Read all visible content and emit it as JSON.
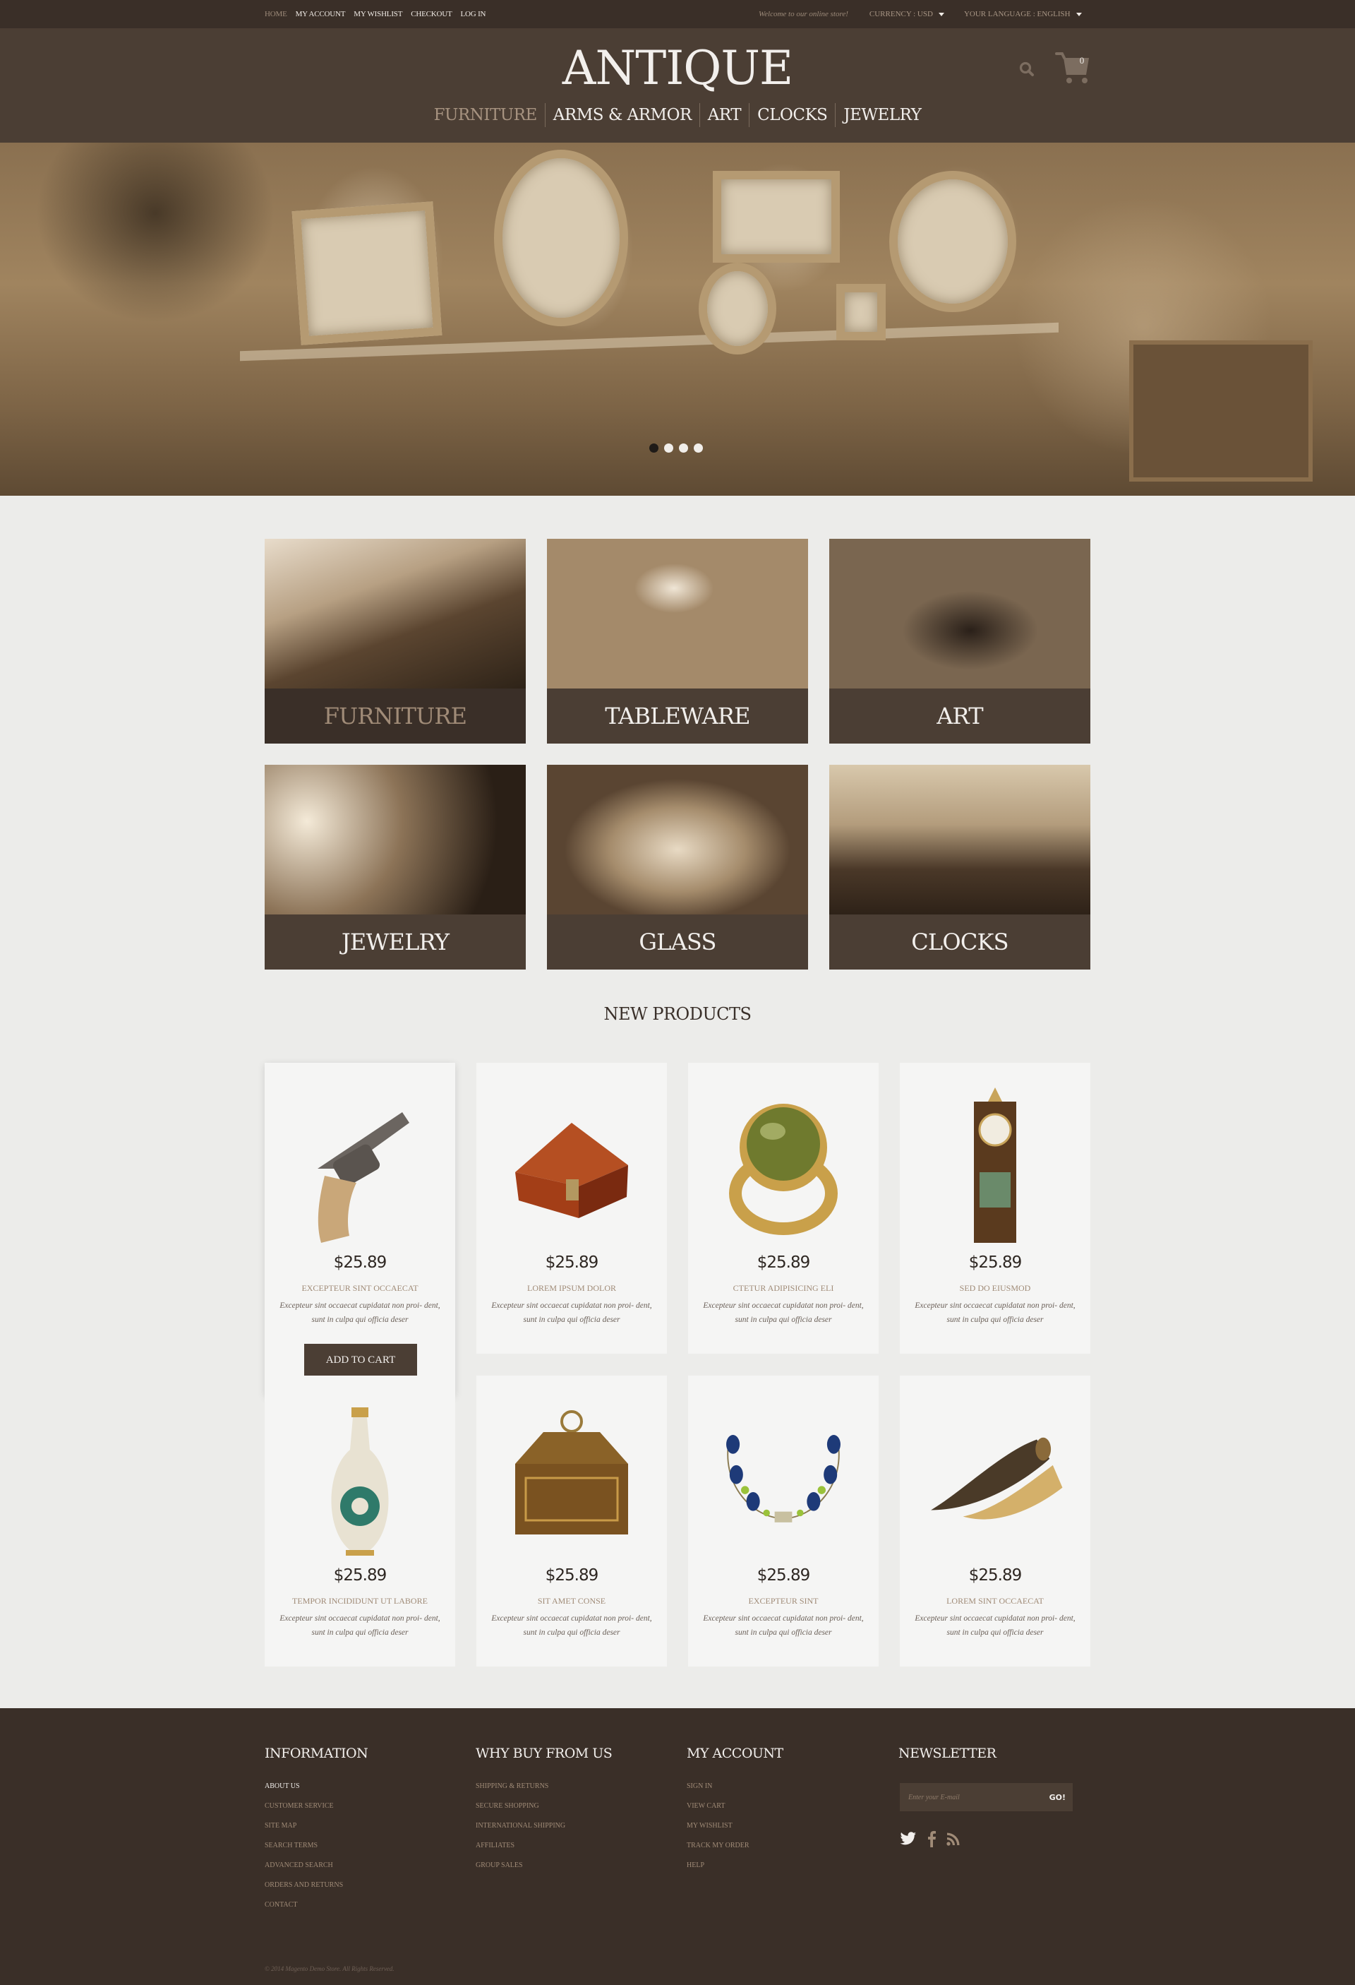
{
  "topbar": {
    "links": [
      {
        "label": "HOME",
        "active": true
      },
      {
        "label": "MY ACCOUNT",
        "active": false
      },
      {
        "label": "MY WISHLIST",
        "active": false
      },
      {
        "label": "CHECKOUT",
        "active": false
      },
      {
        "label": "LOG IN",
        "active": false
      }
    ],
    "welcome": "Welcome to our online store!",
    "currency": "CURRENCY : USD",
    "language": "YOUR LANGUAGE : ENGLISH"
  },
  "header": {
    "logo": "ANTIQUE",
    "cart_count": "0",
    "icons": {
      "search": "search-icon",
      "cart": "cart-icon"
    },
    "nav": [
      {
        "label": "FURNITURE",
        "active": true
      },
      {
        "label": "ARMS & ARMOR",
        "active": false
      },
      {
        "label": "ART",
        "active": false
      },
      {
        "label": "CLOCKS",
        "active": false
      },
      {
        "label": "JEWELRY",
        "active": false
      }
    ]
  },
  "slider": {
    "slide_count": 4,
    "active_slide": 1
  },
  "categories": [
    {
      "label": "FURNITURE",
      "active": true
    },
    {
      "label": "TABLEWARE",
      "active": false
    },
    {
      "label": "ART",
      "active": false
    },
    {
      "label": "JEWELRY",
      "active": false
    },
    {
      "label": "GLASS",
      "active": false
    },
    {
      "label": "CLOCKS",
      "active": false
    }
  ],
  "new_products": {
    "title": "NEW PRODUCTS",
    "add_to_cart_label": "ADD TO CART",
    "items": [
      {
        "price": "$25.89",
        "name": "EXCEPTEUR SINT OCCAECAT",
        "desc": "Excepteur sint occaecat cupidatat non proi- dent, sunt in culpa qui officia deser",
        "image": "revolver"
      },
      {
        "price": "$25.89",
        "name": "LOREM IPSUM DOLOR",
        "desc": "Excepteur sint occaecat cupidatat non proi- dent, sunt in culpa qui officia deser",
        "image": "wooden-chest"
      },
      {
        "price": "$25.89",
        "name": "CTETUR ADIPISICING ELI",
        "desc": "Excepteur sint occaecat cupidatat non proi- dent, sunt in culpa qui officia deser",
        "image": "gem-ring"
      },
      {
        "price": "$25.89",
        "name": "SED DO EIUSMOD",
        "desc": "Excepteur sint occaecat cupidatat non proi- dent, sunt in culpa qui officia deser",
        "image": "mantel-clock"
      },
      {
        "price": "$25.89",
        "name": "TEMPOR INCIDIDUNT UT LABORE",
        "desc": "Excepteur sint occaecat cupidatat non proi- dent, sunt in culpa qui officia deser",
        "image": "vase"
      },
      {
        "price": "$25.89",
        "name": "SIT AMET CONSE",
        "desc": "Excepteur sint occaecat cupidatat non proi- dent, sunt in culpa qui officia deser",
        "image": "ornate-box"
      },
      {
        "price": "$25.89",
        "name": "EXCEPTEUR SINT",
        "desc": "Excepteur sint occaecat cupidatat non proi- dent, sunt in culpa qui officia deser",
        "image": "bead-necklace"
      },
      {
        "price": "$25.89",
        "name": "LOREM SINT OCCAECAT",
        "desc": "Excepteur sint occaecat cupidatat non proi- dent, sunt in culpa qui officia deser",
        "image": "powder-horn"
      }
    ]
  },
  "footer": {
    "columns": [
      {
        "title": "INFORMATION",
        "links": [
          {
            "label": "ABOUT US",
            "active": true
          },
          {
            "label": "CUSTOMER SERVICE"
          },
          {
            "label": "SITE MAP"
          },
          {
            "label": "SEARCH TERMS"
          },
          {
            "label": "ADVANCED SEARCH"
          },
          {
            "label": "ORDERS AND RETURNS"
          },
          {
            "label": "CONTACT"
          }
        ]
      },
      {
        "title": "WHY BUY FROM US",
        "links": [
          {
            "label": "SHIPPING & RETURNS"
          },
          {
            "label": "SECURE SHOPPING"
          },
          {
            "label": "INTERNATIONAL SHIPPING"
          },
          {
            "label": "AFFILIATES"
          },
          {
            "label": "GROUP SALES"
          }
        ]
      },
      {
        "title": "MY ACCOUNT",
        "links": [
          {
            "label": "SIGN IN"
          },
          {
            "label": "VIEW CART"
          },
          {
            "label": "MY WISHLIST"
          },
          {
            "label": "TRACK MY ORDER"
          },
          {
            "label": "HELP"
          }
        ]
      }
    ],
    "newsletter": {
      "title": "NEWSLETTER",
      "placeholder": "Enter your E-mail",
      "value": "",
      "button": "GO!"
    },
    "social": [
      "twitter-icon",
      "facebook-icon",
      "rss-icon"
    ],
    "copyright": "© 2014 Magento Demo Store. All Rights Reserved."
  },
  "colors": {
    "dark_brown": "#3a2f28",
    "header_brown": "#4b3e34",
    "accent_tan": "#a08b77",
    "light_text": "#f2efec",
    "card_bg": "#f5f5f4",
    "page_bg": "#ececea"
  }
}
